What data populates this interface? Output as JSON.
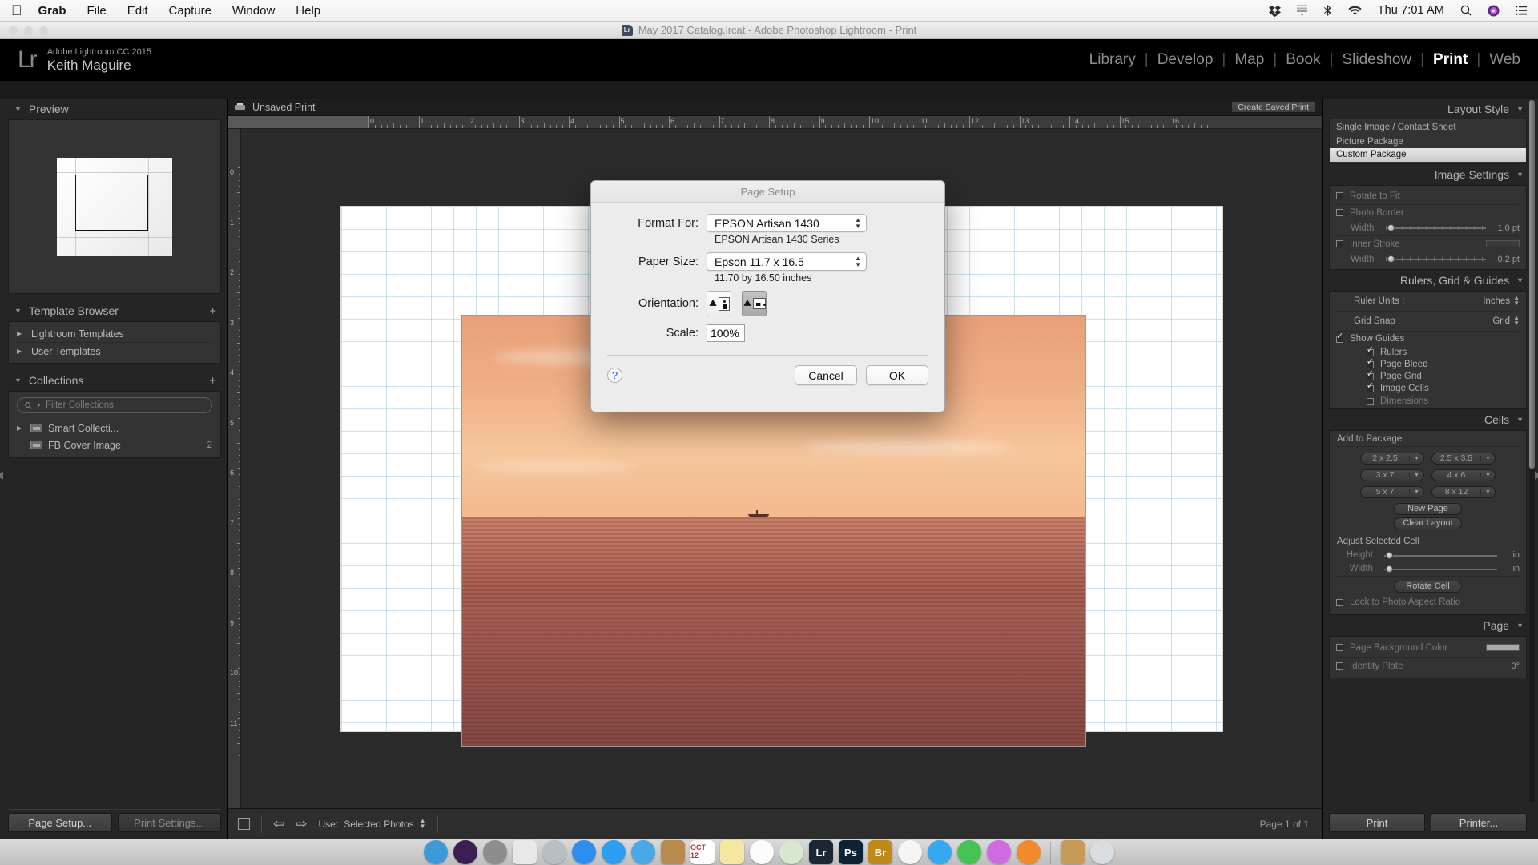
{
  "menubar": {
    "apple_icon": "apple-icon",
    "items": [
      "Grab",
      "File",
      "Edit",
      "Capture",
      "Window",
      "Help"
    ],
    "active_app": "Grab",
    "right": {
      "dropbox_icon": "dropbox-icon",
      "list_icon": "list-icon",
      "bluetooth_icon": "bluetooth-icon",
      "wifi_icon": "wifi-icon",
      "clock": "Thu 7:01 AM",
      "search_icon": "search-icon",
      "siri_icon": "siri-icon",
      "control_center_icon": "control-center-icon"
    }
  },
  "window": {
    "title": "May 2017 Catalog.lrcat - Adobe Photoshop Lightroom - Print",
    "app_icon": "lightroom-icon"
  },
  "identity": {
    "logo": "Lr",
    "product": "Adobe Lightroom CC 2015",
    "user": "Keith Maguire"
  },
  "modules": {
    "items": [
      "Library",
      "Develop",
      "Map",
      "Book",
      "Slideshow",
      "Print",
      "Web"
    ],
    "active": "Print"
  },
  "left_panel": {
    "preview": {
      "title": "Preview"
    },
    "template_browser": {
      "title": "Template Browser",
      "add_icon": "plus-icon",
      "items": [
        "Lightroom Templates",
        "User Templates"
      ]
    },
    "collections": {
      "title": "Collections",
      "add_icon": "plus-collection-icon",
      "filter_placeholder": "Filter Collections",
      "search_icon": "search-icon",
      "items": [
        {
          "label": "Smart Collecti...",
          "count": "",
          "expandable": true
        },
        {
          "label": "FB Cover Image",
          "count": "2",
          "expandable": false
        }
      ]
    },
    "buttons": {
      "page_setup": "Page Setup...",
      "print_settings": "Print Settings..."
    }
  },
  "center": {
    "filmstrip_title": "Unsaved Print",
    "print_icon": "printer-icon",
    "create_saved_print": "Create Saved Print",
    "ruler_top_ticks": [
      "0",
      "1",
      "2",
      "3",
      "4",
      "5",
      "6",
      "7",
      "8",
      "9",
      "10",
      "11",
      "12",
      "13",
      "14",
      "15",
      "16"
    ],
    "ruler_left_ticks": [
      "0",
      "1",
      "2",
      "3",
      "4",
      "5",
      "6",
      "7",
      "8",
      "9",
      "10",
      "11"
    ],
    "toolbar": {
      "cell_icon": "cell-toggle-icon",
      "prev_icon": "arrow-left-icon",
      "next_icon": "arrow-right-icon",
      "use_label": "Use:",
      "use_value": "Selected Photos",
      "page_count": "Page 1 of 1"
    }
  },
  "right_panel": {
    "layout_style": {
      "title": "Layout Style",
      "options": [
        "Single Image / Contact Sheet",
        "Picture Package",
        "Custom Package"
      ],
      "selected": "Custom Package"
    },
    "image_settings": {
      "title": "Image Settings",
      "rotate_to_fit": {
        "label": "Rotate to Fit",
        "checked": false
      },
      "photo_border": {
        "label": "Photo Border",
        "checked": false,
        "width_label": "Width",
        "width_value": "1.0 pt"
      },
      "inner_stroke": {
        "label": "Inner Stroke",
        "checked": false,
        "width_label": "Width",
        "width_value": "0.2 pt",
        "color": "#3a3a3a"
      }
    },
    "rulers_grid_guides": {
      "title": "Rulers, Grid & Guides",
      "ruler_units_label": "Ruler Units :",
      "ruler_units_value": "Inches",
      "grid_snap_label": "Grid Snap :",
      "grid_snap_value": "Grid",
      "show_guides": {
        "label": "Show Guides",
        "checked": true
      },
      "sub_options": [
        {
          "label": "Rulers",
          "checked": true
        },
        {
          "label": "Page Bleed",
          "checked": true
        },
        {
          "label": "Page Grid",
          "checked": true
        },
        {
          "label": "Image Cells",
          "checked": true
        },
        {
          "label": "Dimensions",
          "checked": false
        }
      ]
    },
    "cells": {
      "title": "Cells",
      "add_to_package": "Add to Package",
      "sizes": [
        "2 x 2.5",
        "2.5 x 3.5",
        "3 x 7",
        "4 x 6",
        "5 x 7",
        "8 x 12"
      ],
      "new_page": "New Page",
      "clear_layout": "Clear Layout",
      "adjust_selected_cell": "Adjust Selected Cell",
      "height_label": "Height",
      "height_unit": "in",
      "width_label": "Width",
      "width_unit": "in",
      "rotate_cell": "Rotate Cell",
      "lock_aspect": {
        "label": "Lock to Photo Aspect Ratio",
        "checked": false
      }
    },
    "page": {
      "title": "Page",
      "background_color": {
        "label": "Page Background Color",
        "checked": false,
        "color": "#a9a9a9"
      },
      "identity_plate": {
        "label": "Identity Plate",
        "checked": false,
        "angle": "0°"
      }
    },
    "buttons": {
      "print": "Print",
      "printer": "Printer..."
    }
  },
  "dialog": {
    "title": "Page Setup",
    "format_for": {
      "label": "Format For:",
      "value": "EPSON Artisan 1430",
      "note": "EPSON Artisan 1430 Series"
    },
    "paper_size": {
      "label": "Paper Size:",
      "value": "Epson 11.7 x 16.5",
      "note": "11.70 by 16.50 inches"
    },
    "orientation": {
      "label": "Orientation:",
      "portrait_icon": "orientation-portrait-icon",
      "landscape_icon": "orientation-landscape-icon",
      "selected": "landscape"
    },
    "scale": {
      "label": "Scale:",
      "value": "100%"
    },
    "help_icon": "help-icon",
    "cancel": "Cancel",
    "ok": "OK"
  },
  "dock": {
    "items": [
      {
        "name": "finder",
        "label": "",
        "color": "#3e9ad6"
      },
      {
        "name": "siri",
        "label": "",
        "color": "#3a1f55"
      },
      {
        "name": "system-preferences",
        "label": "",
        "color": "#8d8d8d"
      },
      {
        "name": "xcode-tools",
        "label": "",
        "color": "#e8e8e8"
      },
      {
        "name": "launchpad",
        "label": "",
        "color": "#b9bec4"
      },
      {
        "name": "app-store",
        "label": "",
        "color": "#2e8ef0"
      },
      {
        "name": "safari",
        "label": "",
        "color": "#2e9ef0"
      },
      {
        "name": "mail",
        "label": "",
        "color": "#4aa8e8"
      },
      {
        "name": "contacts",
        "label": "",
        "color": "#b98a4e"
      },
      {
        "name": "calendar",
        "label": "OCT 12",
        "color": "#ffffff"
      },
      {
        "name": "notes",
        "label": "",
        "color": "#f7e6a0"
      },
      {
        "name": "reminders",
        "label": "",
        "color": "#fcfcfc"
      },
      {
        "name": "maps",
        "label": "",
        "color": "#d8e8d0"
      },
      {
        "name": "lightroom",
        "label": "Lr",
        "color": "#1c2733"
      },
      {
        "name": "photoshop",
        "label": "Ps",
        "color": "#0d2233"
      },
      {
        "name": "bridge",
        "label": "Br",
        "color": "#c08a1a"
      },
      {
        "name": "photos",
        "label": "",
        "color": "#f5f5f5"
      },
      {
        "name": "messages",
        "label": "",
        "color": "#36a8f0"
      },
      {
        "name": "facetime",
        "label": "",
        "color": "#45c455"
      },
      {
        "name": "itunes",
        "label": "",
        "color": "#d06ae0"
      },
      {
        "name": "ibooks",
        "label": "",
        "color": "#f08a2a"
      },
      {
        "name": "downloads",
        "label": "",
        "color": "#c89a58"
      },
      {
        "name": "trash",
        "label": "",
        "color": "#d8dde2"
      }
    ],
    "running": [
      "finder",
      "system-preferences",
      "safari",
      "lightroom",
      "photoshop"
    ]
  }
}
